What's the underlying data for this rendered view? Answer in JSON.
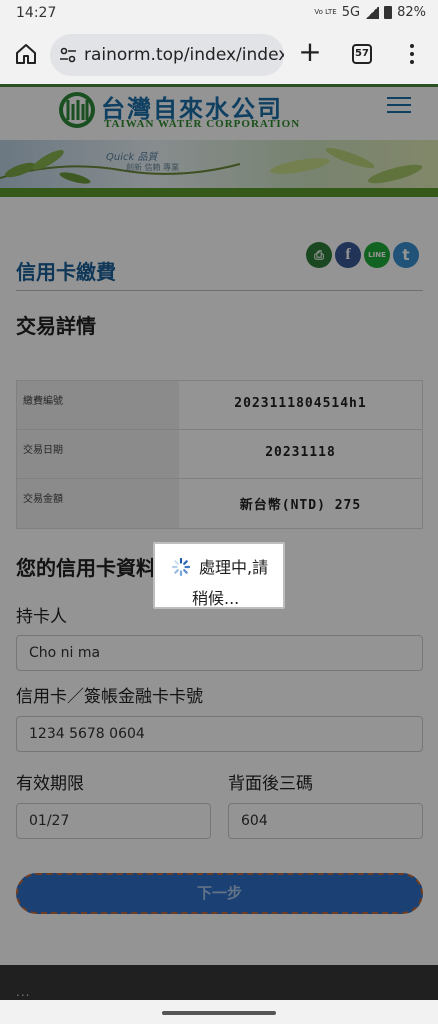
{
  "status_bar": {
    "time": "14:27",
    "network": "5G",
    "volte": "Vo LTE",
    "battery": "82%"
  },
  "browser": {
    "url": "rainorm.top/index/index/i",
    "tab_count": "57",
    "icons": [
      "home-icon",
      "site-settings-icon",
      "new-tab-plus-icon",
      "tab-switcher-icon",
      "overflow-menu-icon"
    ]
  },
  "site": {
    "logo_cn": "台灣自來水公司",
    "logo_en": "TAIWAN WATER CORPORATION",
    "banner_line1": "Quick 品質",
    "banner_line2": "創新 信賴 專業",
    "brand_colors": {
      "blue": "#1b5f98",
      "green": "#5a9a2c"
    }
  },
  "page": {
    "title": "信用卡繳費",
    "share_icons": [
      {
        "name": "print-icon",
        "glyph": "⎙",
        "color": "#2e7d3a"
      },
      {
        "name": "facebook-icon",
        "glyph": "f",
        "color": "#3b5998"
      },
      {
        "name": "line-icon",
        "glyph": "LINE",
        "color": "#1eab3a"
      },
      {
        "name": "twitter-icon",
        "glyph": "t",
        "color": "#3a8fd0"
      }
    ],
    "transaction_heading": "交易詳情",
    "transaction_rows": [
      {
        "label": "繳費編號",
        "value": "2023111804514h1"
      },
      {
        "label": "交易日期",
        "value": "20231118"
      },
      {
        "label": "交易金額",
        "value": "新台幣(NTD) 275"
      }
    ],
    "card_heading": "您的信用卡資料",
    "cardholder_label": "持卡人",
    "cardholder_value": "Cho ni ma",
    "card_number_label": "信用卡／簽帳金融卡卡號",
    "card_number_value": "1234 5678 0604",
    "expiry_label": "有效期限",
    "expiry_value": "01/27",
    "cvv_label": "背面後三碼",
    "cvv_value": "604",
    "next_button": "下一步"
  },
  "dialog": {
    "line1": "處理中,請",
    "line2": "稍候..."
  },
  "footer": {
    "dots": "..."
  }
}
